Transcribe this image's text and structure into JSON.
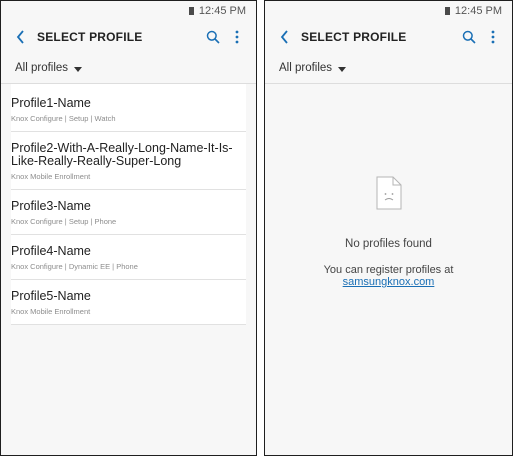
{
  "left": {
    "status": {
      "time": "12:45 PM"
    },
    "app_bar": {
      "title": "SELECT PROFILE"
    },
    "filter": {
      "label": "All profiles"
    },
    "profiles": [
      {
        "name": "Profile1-Name",
        "detail": "Knox Configure | Setup | Watch"
      },
      {
        "name": "Profile2-With-A-Really-Long-Name-It-Is-Like-Really-Really-Super-Long",
        "detail": "Knox Mobile Enrollment"
      },
      {
        "name": "Profile3-Name",
        "detail": "Knox Configure | Setup | Phone"
      },
      {
        "name": "Profile4-Name",
        "detail": "Knox Configure | Dynamic EE | Phone"
      },
      {
        "name": "Profile5-Name",
        "detail": "Knox Mobile Enrollment"
      }
    ]
  },
  "right": {
    "status": {
      "time": "12:45 PM"
    },
    "app_bar": {
      "title": "SELECT PROFILE"
    },
    "filter": {
      "label": "All profiles"
    },
    "empty_state": {
      "title": "No profiles found",
      "message": "You can register profiles at",
      "link": "samsungknox.com"
    }
  },
  "colors": {
    "accent": "#1a6fb5",
    "text": "#222222",
    "secondary_text": "#8d8d8d",
    "background": "#f7f7f7"
  },
  "icons": {
    "back": "chevron-left-icon",
    "search": "search-icon",
    "more": "more-vertical-icon",
    "dropdown": "dropdown-arrow-icon",
    "empty": "sad-document-icon",
    "battery": "battery-icon"
  }
}
